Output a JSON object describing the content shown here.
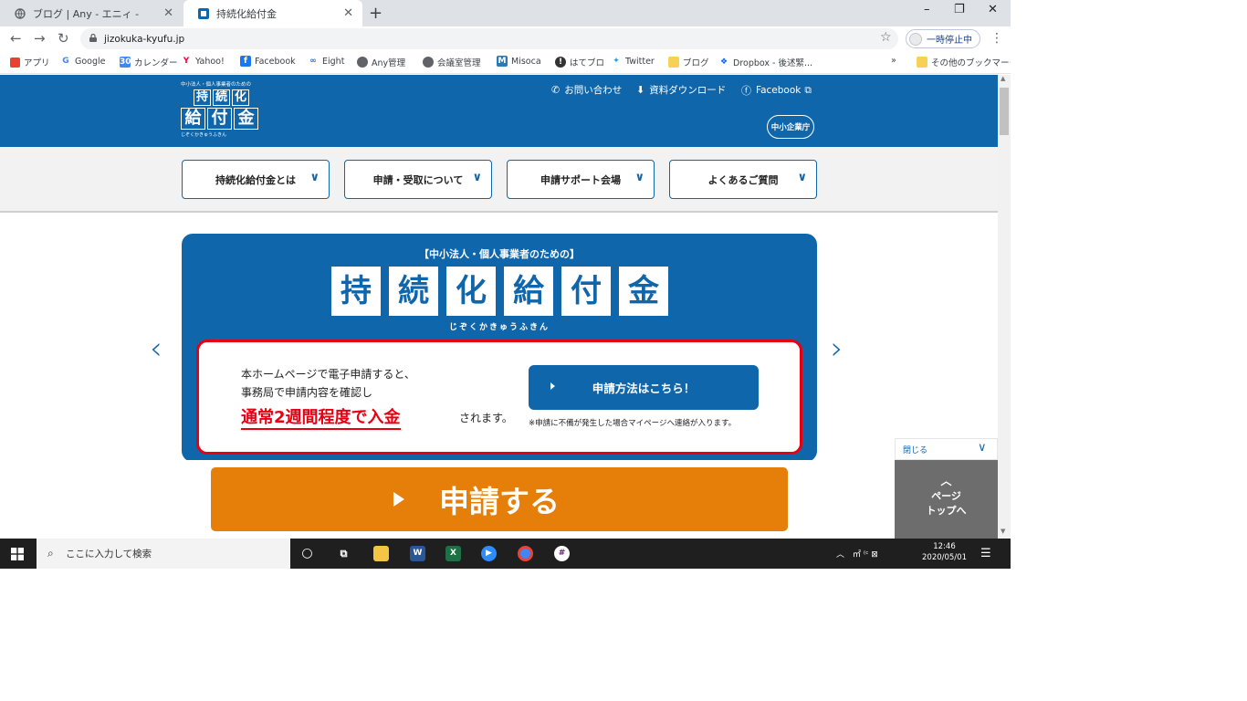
{
  "browser": {
    "tabs": [
      {
        "title": "ブログ | Any - エニィ -",
        "active": false
      },
      {
        "title": "持続化給付金",
        "active": true
      }
    ],
    "new_tab": "+",
    "window_controls": {
      "minimize": "–",
      "maximize": "❐",
      "close": "✕"
    },
    "url": "jizokuka-kyufu.jp",
    "profile_label": "一時停止中",
    "bookmarks": [
      {
        "label": "アプリ",
        "icon": "apps-grid-icon"
      },
      {
        "label": "Google",
        "icon": "google-icon"
      },
      {
        "label": "カレンダー",
        "icon": "calendar-icon"
      },
      {
        "label": "Yahoo!",
        "icon": "yahoo-icon"
      },
      {
        "label": "Facebook",
        "icon": "facebook-icon"
      },
      {
        "label": "Eight",
        "icon": "eight-icon"
      },
      {
        "label": "Any管理",
        "icon": "globe-icon"
      },
      {
        "label": "会議室管理",
        "icon": "globe-icon"
      },
      {
        "label": "Misoca",
        "icon": "misoca-icon"
      },
      {
        "label": "はてブロ",
        "icon": "hatena-icon"
      },
      {
        "label": "Twitter",
        "icon": "twitter-icon"
      },
      {
        "label": "ブログ",
        "icon": "folder-icon"
      },
      {
        "label": "Dropbox - 後述緊...",
        "icon": "dropbox-icon"
      }
    ],
    "bookmarks_more": "»",
    "other_bookmarks": "その他のブックマーク"
  },
  "site": {
    "logo": {
      "tagline": "中小法人・個人事業者のための",
      "line1": [
        "持",
        "続",
        "化"
      ],
      "line2": [
        "給",
        "付",
        "金"
      ],
      "kana": "じぞくかきゅうふきん"
    },
    "header_links": [
      {
        "label": "お問い合わせ",
        "icon": "phone-icon"
      },
      {
        "label": "資料ダウンロード",
        "icon": "download-icon"
      },
      {
        "label": "Facebook",
        "icon": "facebook-icon"
      }
    ],
    "agency_logo": "中小企業庁",
    "nav": [
      {
        "label": "持続化給付金とは"
      },
      {
        "label": "申請・受取について"
      },
      {
        "label": "申請サポート会場"
      },
      {
        "label": "よくあるご質問"
      }
    ],
    "hero": {
      "subtitle": "【中小法人・個人事業者のための】",
      "title_chars": [
        "持",
        "続",
        "化",
        "給",
        "付",
        "金"
      ],
      "kana": "じぞくかきゅうふきん",
      "card_line1": "本ホームページで電子申請すると、",
      "card_line2": "事務局で申請内容を確認し",
      "card_highlight": "通常2週間程度で入金",
      "card_suffix": "されます。",
      "button_label": "申請方法はこちら！",
      "note": "※申請に不備が発生した場合マイページへ連絡が入ります。"
    },
    "big_button": "申請する",
    "close_label": "閉じる",
    "page_top": {
      "line1": "ページ",
      "line2": "トップへ"
    }
  },
  "taskbar": {
    "search_placeholder": "ここに入力して検索",
    "tray_text": "㎡ ⁽ᶜ ⊠",
    "time": "12:46",
    "date": "2020/05/01"
  },
  "colors": {
    "brand_blue": "#0f66ab",
    "accent_red": "#e60012",
    "cta_orange": "#e67e0a"
  }
}
